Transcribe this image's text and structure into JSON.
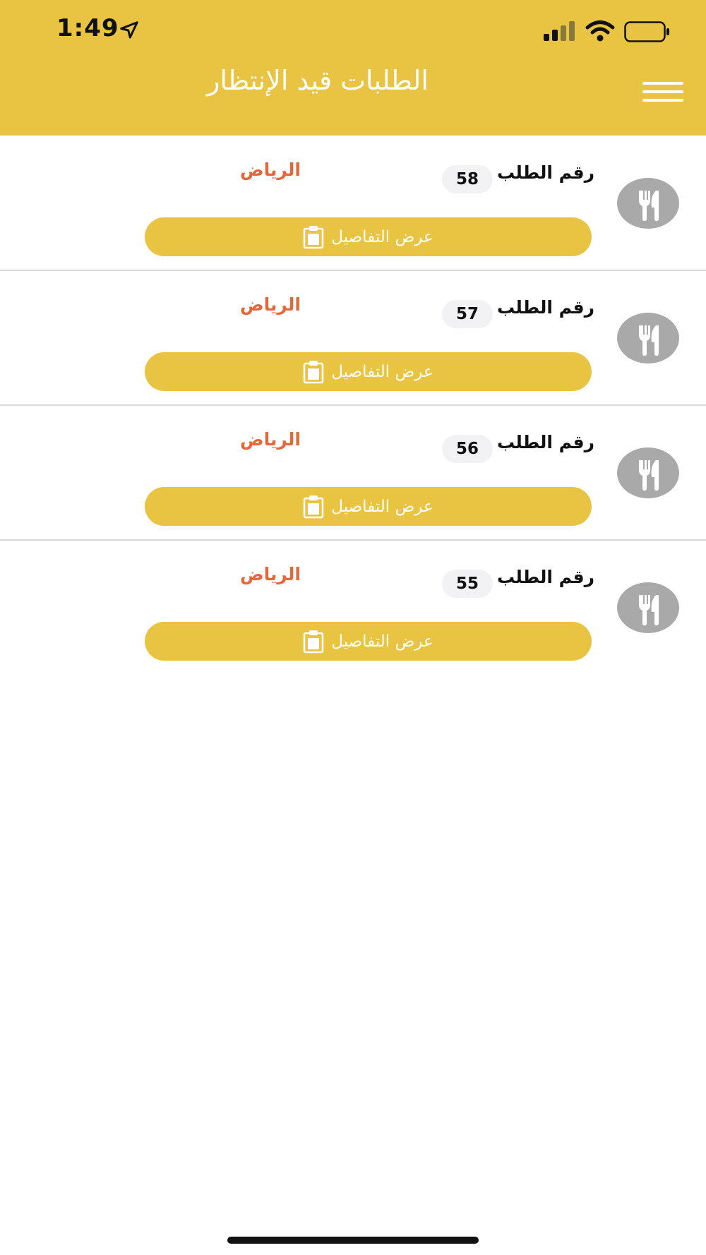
{
  "status_bar": {
    "time": "1:49",
    "icons": [
      "location-arrow-icon",
      "signal-icon",
      "wifi-icon",
      "battery-icon"
    ]
  },
  "header": {
    "title": "الطلبات قيد الإنتظار",
    "menu_icon": "hamburger-menu-icon",
    "background": "#E9C442"
  },
  "orders": [
    {
      "label": "رقم الطلب",
      "number": "58",
      "city": "الرياض",
      "button": "عرض التفاصيل"
    },
    {
      "label": "رقم الطلب",
      "number": "57",
      "city": "الرياض",
      "button": "عرض التفاصيل"
    },
    {
      "label": "رقم الطلب",
      "number": "56",
      "city": "الرياض",
      "button": "عرض التفاصيل"
    },
    {
      "label": "رقم الطلب",
      "number": "55",
      "city": "الرياض",
      "button": "عرض التفاصيل"
    }
  ],
  "colors": {
    "accent": "#E9C442",
    "city_text": "#E0683A",
    "avatar_bg": "#A9A9A9",
    "badge_bg": "#F2F2F4"
  }
}
